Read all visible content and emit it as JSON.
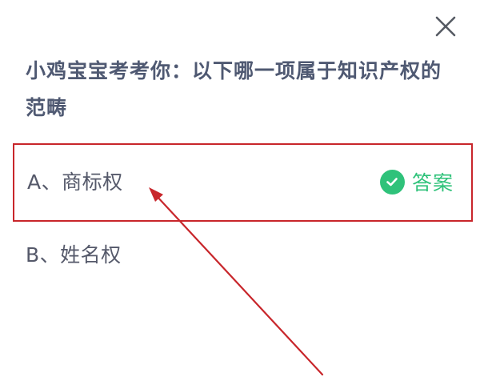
{
  "dialog": {
    "close_icon": "close-icon",
    "question": "小鸡宝宝考考你：以下哪一项属于知识产权的范畴",
    "options": [
      {
        "label": "A、商标权",
        "is_answer": true,
        "answer_text": "答案",
        "answer_icon": "check-circle-icon"
      },
      {
        "label": "B、姓名权",
        "is_answer": false
      }
    ]
  },
  "colors": {
    "highlight_border": "#c8262b",
    "answer_green": "#2fc27a",
    "question_text": "#4f5972",
    "option_text": "#55596a",
    "arrow": "#c8262b"
  }
}
